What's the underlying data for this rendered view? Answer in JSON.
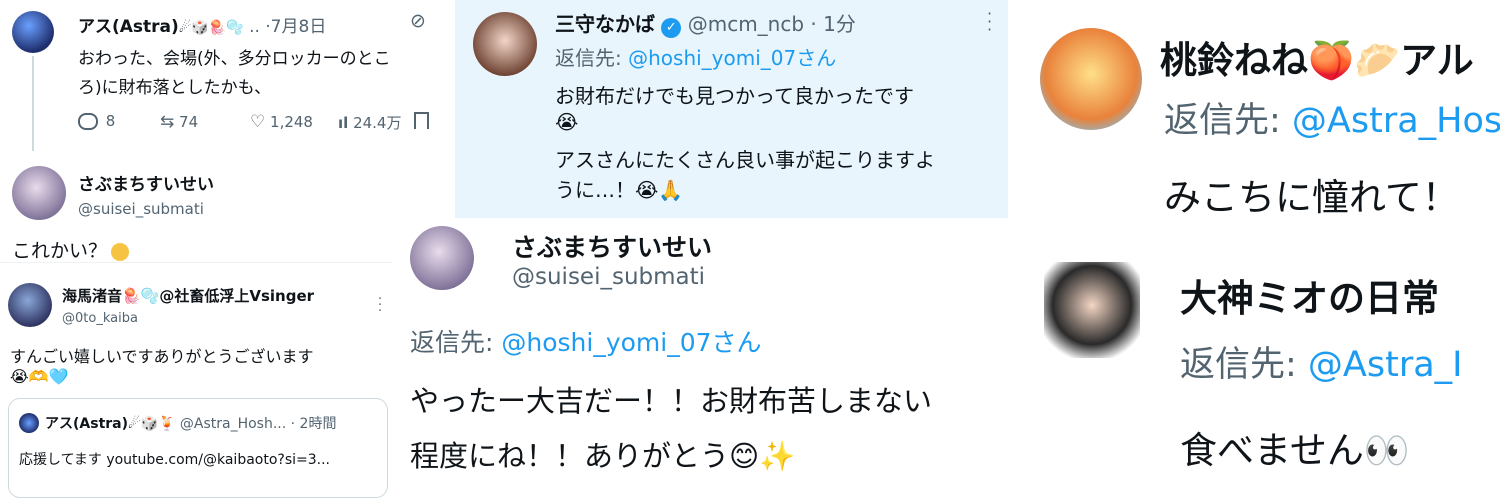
{
  "panel1": {
    "author_name": "アス(Astra)",
    "author_emoji": "☄🎲🪼🫧",
    "time_sep": "..",
    "date": "·7月8日",
    "text_line1": "おわった、会場(外、多分ロッカーのとこ",
    "text_line2": "ろ)に財布落としたかも、",
    "replies": "8",
    "retweets": "74",
    "likes": "1,248",
    "views": "24.4万",
    "reply_author": "さぶまちすいせい",
    "reply_handle": "@suisei_submati",
    "reply_text": "これかい？"
  },
  "panel2": {
    "author_name": "三守なかば",
    "verified_mark": "✓",
    "handle_time": "@mcm_ncb · 1分",
    "reply_to_prefix": "返信先: ",
    "reply_to_handle": "@hoshi_yomi_07さん",
    "text_line1": "お財布だけでも見つかって良かったです",
    "text_line2": "😭",
    "text_line3": "アスさんにたくさん良い事が起こりますよ",
    "text_line4": "うに…！😭🙏"
  },
  "panel3": {
    "author_name": "海馬渚音🪼🫧@社畜低浮上Vsinger",
    "handle": "@0to_kaiba",
    "text_line1": "すんごい嬉しいですありがとうございます",
    "text_line2": "😭🫶🩵",
    "quote_author": "アス(Astra)☄🎲🍹",
    "quote_handle_time": "@Astra_Hosh... · 2時間",
    "quote_text": "応援してます youtube.com/@kaibaoto?si=3..."
  },
  "panel4": {
    "author_name": "さぶまちすいせい",
    "handle": "@suisei_submati",
    "reply_to_prefix": "返信先: ",
    "reply_to_handle": "@hoshi_yomi_07さん",
    "text_line1": "やったー大吉だー！！お財布苦しまない",
    "text_line2": "程度にね！！ありがとう😊✨"
  },
  "panel5": {
    "author1_name": "桃鈴ねね🍑🥟アル",
    "reply_to_prefix1": "返信先: ",
    "reply_to_handle1": "@Astra_Hos",
    "text1": "みこちに憧れて！",
    "author2_name": "大神ミオの日常",
    "reply_to_prefix2": "返信先: ",
    "reply_to_handle2": "@Astra_I",
    "text2": "食べません👀"
  },
  "colors": {
    "accent": "#1d9bf0",
    "muted": "#536471",
    "highlight_bg": "#e8f5fd"
  }
}
